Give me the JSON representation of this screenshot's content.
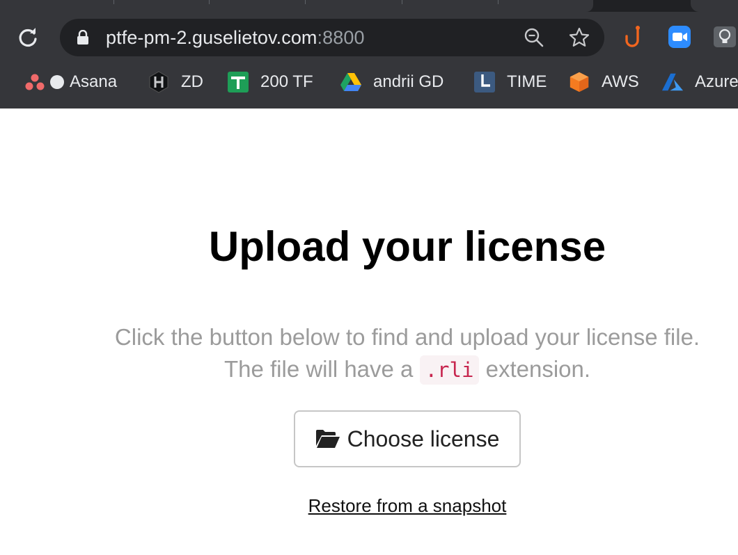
{
  "browser": {
    "url_host": "ptfe-pm-2.guselietov.com",
    "url_port": ":8800",
    "bookmarks": [
      {
        "label": "Asana",
        "icon": "asana-icon"
      },
      {
        "label": "ZD",
        "icon": "hashicorp-icon"
      },
      {
        "label": "200 TF",
        "icon": "sheets-icon"
      },
      {
        "label": "andrii  GD",
        "icon": "drive-icon"
      },
      {
        "label": "TIME",
        "icon": "clock-icon"
      },
      {
        "label": "AWS",
        "icon": "aws-icon"
      },
      {
        "label": "Azure",
        "icon": "azure-icon"
      }
    ]
  },
  "page": {
    "title": "Upload your license",
    "description_line1": "Click the button below to find and upload your license file.",
    "description_prefix": "The file will have a ",
    "description_code": ".rli",
    "description_suffix": " extension.",
    "choose_button": "Choose license",
    "restore_link": "Restore from a snapshot"
  },
  "colors": {
    "chrome_bg": "#35363a",
    "omnibox_bg": "#202124",
    "code_text": "#c7254e",
    "muted_text": "#9b9b9b"
  }
}
